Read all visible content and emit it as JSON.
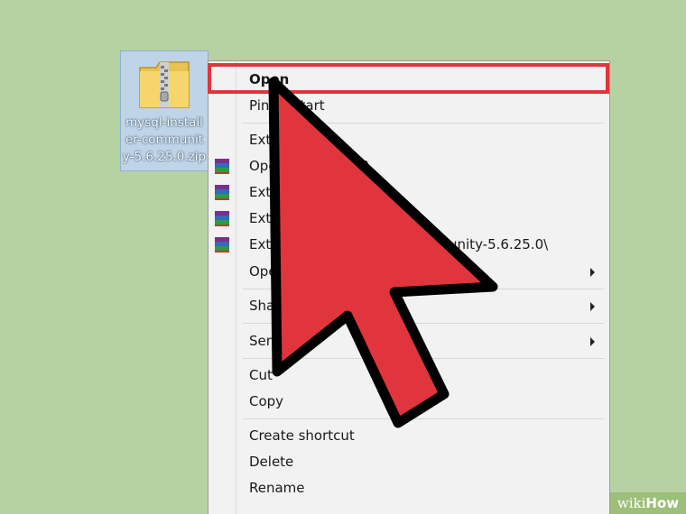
{
  "desktop": {
    "file_name_lines": [
      "mysql-install",
      "er-communit",
      "y-5.6.25.0.zip"
    ],
    "file_icon": "zip-folder-icon"
  },
  "context_menu": {
    "items": [
      {
        "label": "Open",
        "bold": true,
        "icon": ""
      },
      {
        "label": "Pin to Start",
        "icon": ""
      },
      {
        "label": "Extr",
        "icon": ""
      },
      {
        "label": "Ope",
        "icon": "winrar-icon",
        "extra": "R"
      },
      {
        "label": "Extr",
        "icon": "winrar-icon"
      },
      {
        "label": "Extr",
        "icon": "winrar-icon"
      },
      {
        "label": "Extr",
        "icon": "winrar-icon",
        "extra": "unity-5.6.25.0\\"
      },
      {
        "label": "Ope",
        "icon": "",
        "submenu": true
      },
      {
        "label": "Sha",
        "icon": "",
        "submenu": true
      },
      {
        "label": "Sen",
        "icon": "",
        "submenu": true
      },
      {
        "label": "Cut",
        "icon": ""
      },
      {
        "label": "Copy",
        "icon": ""
      },
      {
        "label": "Create shortcut",
        "icon": ""
      },
      {
        "label": "Delete",
        "icon": ""
      },
      {
        "label": "Rename",
        "icon": ""
      }
    ],
    "highlight_color": "#e0353d"
  },
  "pointer": {
    "color": "#e0353d",
    "outline": "#000000",
    "icon": "arrow-pointer-icon"
  },
  "watermark": {
    "prefix": "wiki",
    "suffix": "How"
  }
}
